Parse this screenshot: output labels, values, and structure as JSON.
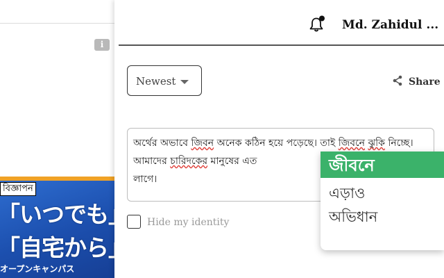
{
  "background": {
    "ad": {
      "label": "বিজ্ঞাপন",
      "line1": "「いつでも」",
      "line2": "「自宅から」",
      "line3": "オープンキャンパス"
    },
    "info_icon": "i"
  },
  "header": {
    "user_name": "Md. Zahidul ...",
    "bell_icon": "bell-icon"
  },
  "controls": {
    "sort_selected": "Newest",
    "share_label": "Share"
  },
  "comment": {
    "p1": "অর্থের অভাবে ",
    "w1": "জিবন",
    "p2": " অনেক কঠিন হয়ে পড়েছে।  তাই ",
    "w2": "জিবনে",
    "p3": " ",
    "w3": "ঝুকি",
    "p4": " নিচ্ছে।  আমাদের ",
    "w4": "চারিদকের",
    "p5": " মানুষের এত",
    "p6": " লাগে।"
  },
  "hide_identity_label": "Hide my identity",
  "suggestions": {
    "top": "জীবনে",
    "items": [
      "এড়াও",
      "অভিধান"
    ]
  },
  "colors": {
    "accent_green": "#3bb26a",
    "spell_error": "#e0413b",
    "ad_blue": "#1c4fae"
  }
}
